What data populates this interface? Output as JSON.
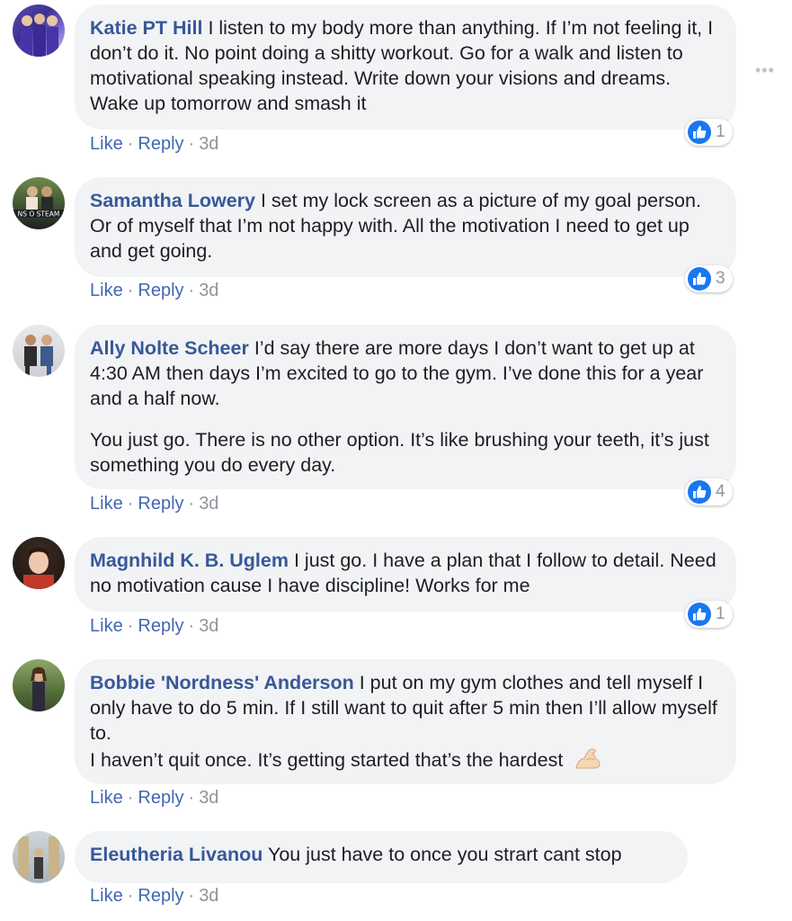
{
  "more_icon": "more-dots-icon",
  "reaction_icon": "like-thumb-icon",
  "comments": [
    {
      "author": "Katie PT Hill",
      "paragraphs": [
        "I listen to my body more than anything. If I’m not feeling it, I don’t do it. No point doing a shitty workout. Go for a walk and listen to motivational speaking instead. Write down your visions and dreams. Wake up tomorrow and smash it"
      ],
      "like_label": "Like",
      "reply_label": "Reply",
      "time": "3d",
      "reactions": "1"
    },
    {
      "author": "Samantha Lowery",
      "paragraphs": [
        "I set my lock screen as a picture of my goal person. Or of myself that I’m not happy with. All the motivation I need to get up and get going."
      ],
      "like_label": "Like",
      "reply_label": "Reply",
      "time": "3d",
      "reactions": "3"
    },
    {
      "author": "Ally Nolte Scheer",
      "paragraphs": [
        "I’d say there are more days I don’t want to get up at 4:30 AM then days I’m excited to go to the gym. I’ve done this for a year and a half now.",
        "You just go. There is no other option. It’s like brushing your teeth, it’s just something you do every day."
      ],
      "like_label": "Like",
      "reply_label": "Reply",
      "time": "3d",
      "reactions": "4"
    },
    {
      "author": "Magnhild K. B. Uglem",
      "paragraphs": [
        "I just go. I have a plan that I follow to detail. Need no motivation cause I have discipline! Works for me"
      ],
      "like_label": "Like",
      "reply_label": "Reply",
      "time": "3d",
      "reactions": "1"
    },
    {
      "author": "Bobbie 'Nordness' Anderson",
      "paragraphs": [
        "I put on my gym clothes and tell myself I only have to do 5 min. If I still want to quit after 5 min then I’ll allow myself to.",
        "I haven’t quit once. It’s getting started that’s the hardest"
      ],
      "emoji": "flexed-biceps-emoji",
      "like_label": "Like",
      "reply_label": "Reply",
      "time": "3d"
    },
    {
      "author": "Eleutheria Livanou",
      "paragraphs": [
        "You just have to once you strart cant stop"
      ],
      "like_label": "Like",
      "reply_label": "Reply",
      "time": "3d"
    }
  ]
}
